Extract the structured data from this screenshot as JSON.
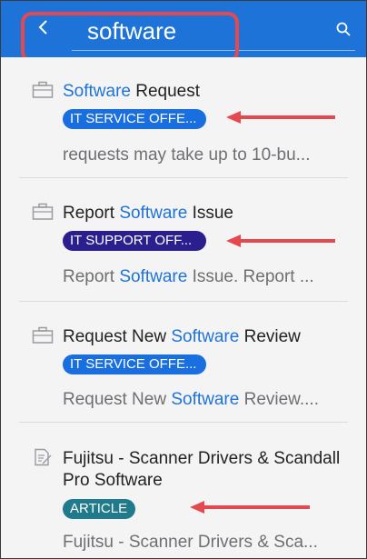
{
  "search": {
    "query": "software"
  },
  "results": [
    {
      "title_parts": [
        "",
        "Software",
        " Request"
      ],
      "badge": "IT SERVICE OFFE...",
      "badge_color": "#1a6fe0",
      "description_parts": [
        "requests may take up to 10-bu..."
      ]
    },
    {
      "title_parts": [
        "Report ",
        "Software",
        " Issue"
      ],
      "badge": "IT SUPPORT OFF...",
      "badge_color": "#2b1f8f",
      "description_parts": [
        "Report ",
        "Software",
        " Issue. Report ..."
      ]
    },
    {
      "title_parts": [
        "Request New ",
        "Software",
        " Review"
      ],
      "badge": "IT SERVICE OFFE...",
      "badge_color": "#1a6fe0",
      "description_parts": [
        "Request New ",
        "Software",
        " Review...."
      ]
    },
    {
      "title_line1": "Fujitsu - Scanner Drivers & Scandall",
      "title_line2": "Pro Software",
      "badge": "ARTICLE",
      "badge_color": "#1f7a8c",
      "description_parts": [
        "Fujitsu - Scanner Drivers & Sca..."
      ]
    }
  ],
  "colors": {
    "header": "#1e73d9",
    "annotation": "#e5484f",
    "highlight": "#1e73d9"
  },
  "icons": [
    "back-arrow-icon",
    "search-icon",
    "briefcase-icon",
    "document-icon",
    "red-arrow-icon"
  ]
}
